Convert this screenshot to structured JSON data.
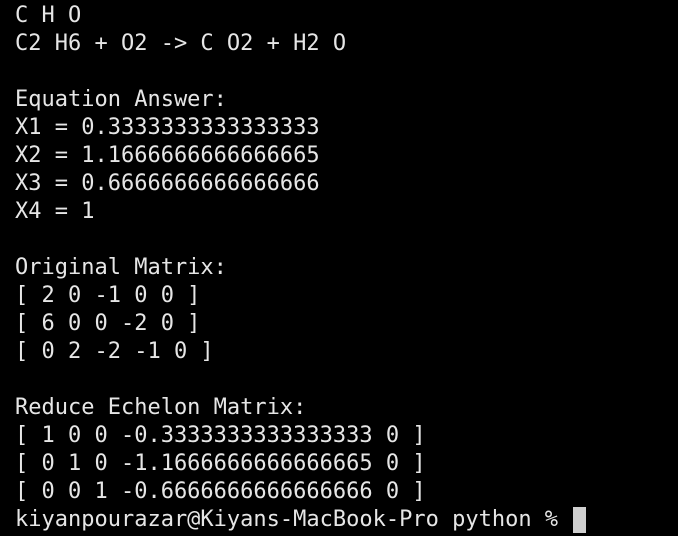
{
  "terminal": {
    "clipped_top_text": "        ",
    "lines": [
      "C H O",
      "C2 H6 + O2 -> C O2 + H2 O",
      "",
      "Equation Answer:",
      "X1 = 0.3333333333333333",
      "X2 = 1.1666666666666665",
      "X3 = 0.6666666666666666",
      "X4 = 1",
      "",
      "Original Matrix:",
      "[ 2 0 -1 0 0 ]",
      "[ 6 0 0 -2 0 ]",
      "[ 0 2 -2 -1 0 ]",
      "",
      "Reduce Echelon Matrix:",
      "[ 1 0 0 -0.3333333333333333 0 ]",
      "[ 0 1 0 -1.1666666666666665 0 ]",
      "[ 0 0 1 -0.6666666666666666 0 ]"
    ],
    "prompt": "kiyanpourazar@Kiyans-MacBook-Pro python % "
  }
}
